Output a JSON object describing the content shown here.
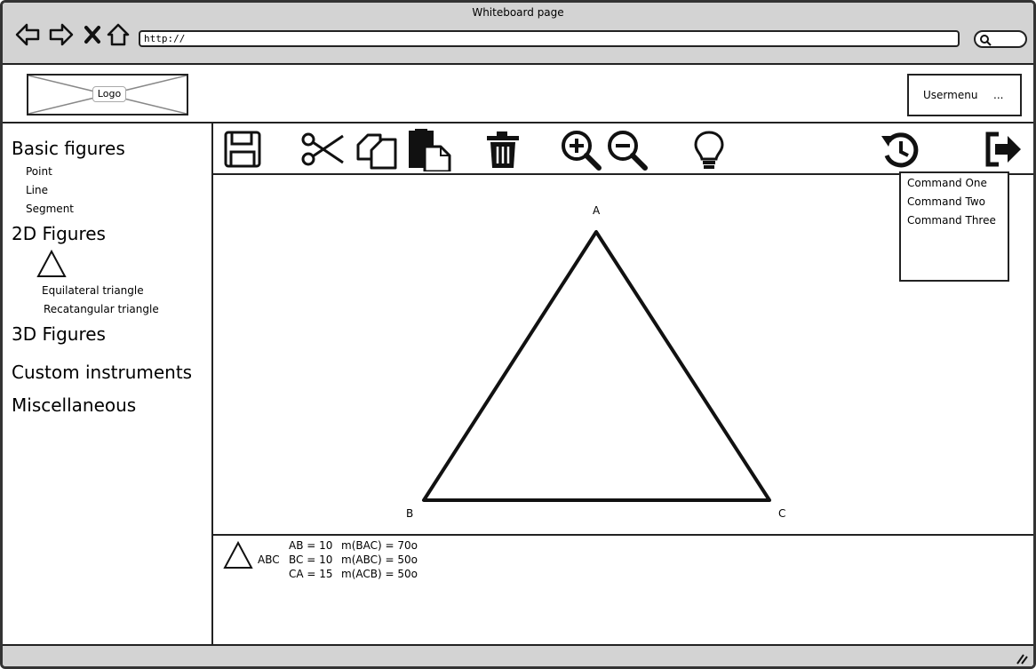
{
  "window": {
    "title": "Whiteboard page"
  },
  "browser": {
    "url": "http://",
    "icons": [
      "back-arrow-icon",
      "forward-arrow-icon",
      "close-x-icon",
      "home-icon",
      "search-icon"
    ]
  },
  "header": {
    "logo": "Logo",
    "usermenu": "Usermenu",
    "usermenu_more": "..."
  },
  "sidebar": {
    "basic": {
      "title": "Basic figures",
      "items": [
        "Point",
        "Line",
        "Segment"
      ]
    },
    "two_d": {
      "title": "2D Figures",
      "items": [
        "Equilateral triangle",
        "Recatangular triangle"
      ]
    },
    "three_d": {
      "title": "3D Figures"
    },
    "custom": {
      "title": "Custom instruments"
    },
    "misc": {
      "title": "Miscellaneous"
    }
  },
  "toolbar": {
    "icons": [
      "save-icon",
      "cut-icon",
      "copy-icon",
      "paste-icon",
      "delete-icon",
      "zoom-in-icon",
      "zoom-out-icon",
      "hint-icon",
      "history-icon",
      "exit-icon"
    ]
  },
  "dropdown": {
    "items": [
      "Command One",
      "Command Two",
      "Command Three"
    ]
  },
  "canvas": {
    "vertices": {
      "a": "A",
      "b": "B",
      "c": "C"
    }
  },
  "info": {
    "name": "ABC",
    "sides": [
      "AB = 10",
      "BC = 10",
      "CA = 15"
    ],
    "angles": [
      "m(BAC) = 70o",
      "m(ABC) = 50o",
      "m(ACB) = 50o"
    ]
  }
}
